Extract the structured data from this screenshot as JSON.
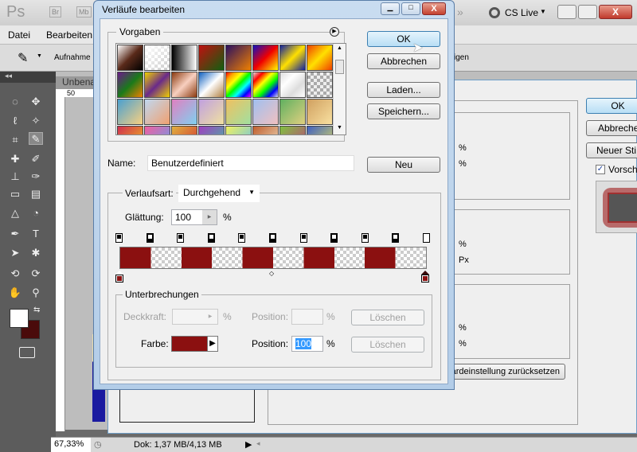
{
  "app": {
    "logo": "Ps",
    "br": "Br",
    "mb": "Mb",
    "cs_live": "CS Live",
    "menu": [
      "Datei",
      "Bearbeiten"
    ],
    "options_label": "Aufnahme",
    "options_tail": "igen",
    "doc_tab": "Unbenannt-",
    "ruler_top": "50",
    "zoom": "67,33%",
    "doc_info": "Dok: 1,37 MB/4,13 MB"
  },
  "layer_style": {
    "ok": "OK",
    "cancel": "Abbrechen",
    "new_style": "Neuer Sti",
    "preview_label": "Vorsch",
    "preview_checked": true,
    "reset": "dardeinstellung zurücksetzen",
    "units": [
      "%",
      "%",
      "%",
      "Px",
      "%",
      "%"
    ]
  },
  "gradient_editor": {
    "title": "Verläufe bearbeiten",
    "presets_label": "Vorgaben",
    "buttons": {
      "ok": "OK",
      "cancel": "Abbrechen",
      "load": "Laden...",
      "save": "Speichern...",
      "new": "Neu"
    },
    "name_label": "Name:",
    "name_value": "Benutzerdefiniert",
    "type_label": "Verlaufsart:",
    "type_value": "Durchgehend",
    "smooth_label": "Glättung:",
    "smooth_value": "100",
    "smooth_unit": "%",
    "stops_group": "Unterbrechungen",
    "opacity_label": "Deckkraft:",
    "opacity_value": "",
    "opacity_unit": "%",
    "position_label": "Position:",
    "position_unit": "%",
    "delete": "Löschen",
    "color_label": "Farbe:",
    "color_value": "#8b1010",
    "color_position_label": "Position:",
    "color_position_value": "100",
    "color_position_unit": "%"
  }
}
